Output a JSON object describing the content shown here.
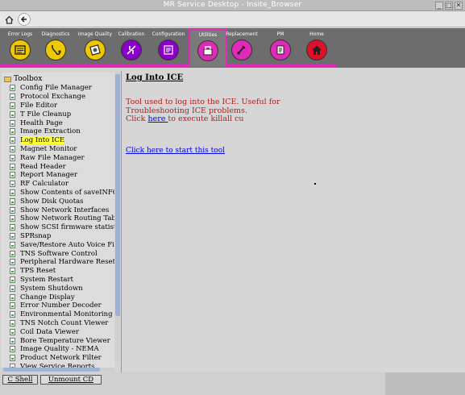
{
  "window": {
    "title": "MR Service Desktop - Insite_Browser",
    "buttons": {
      "minimize": "_",
      "maximize": "□",
      "close": "✕"
    }
  },
  "toolbar": {
    "home_icon": "home-icon",
    "back_icon": "back-arrow-icon",
    "tools": [
      {
        "label": "Error Logs",
        "icon": "error-logs-icon",
        "color": "#f0c800"
      },
      {
        "label": "Diagnostics",
        "icon": "stethoscope-icon",
        "color": "#f0c800"
      },
      {
        "label": "Image Quality",
        "icon": "image-quality-icon",
        "color": "#f0c800"
      },
      {
        "label": "Calibration",
        "icon": "calibration-icon",
        "color": "#8a00c8"
      },
      {
        "label": "Configuration",
        "icon": "configuration-icon",
        "color": "#8a00c8"
      },
      {
        "label": "Utilities",
        "icon": "utilities-icon",
        "color": "#e02ab8",
        "active": true
      },
      {
        "label": "Replacement",
        "icon": "replacement-icon",
        "color": "#e02ab8"
      },
      {
        "label": "PM",
        "icon": "pm-icon",
        "color": "#e02ab8"
      },
      {
        "label": "Home",
        "icon": "home-red-icon",
        "color": "#e0102a"
      }
    ]
  },
  "sidebar": {
    "root_label": "Toolbox",
    "items": [
      {
        "label": "Config File Manager"
      },
      {
        "label": "Protocol Exchange"
      },
      {
        "label": "File Editor"
      },
      {
        "label": "T File Cleanup"
      },
      {
        "label": "Health Page"
      },
      {
        "label": "Image Extraction"
      },
      {
        "label": "Log Into ICE",
        "selected": true
      },
      {
        "label": "Magnet Monitor"
      },
      {
        "label": "Raw File Manager"
      },
      {
        "label": "Read Header"
      },
      {
        "label": "Report Manager"
      },
      {
        "label": "RF Calculator"
      },
      {
        "label": "Show Contents of saveINFO"
      },
      {
        "label": "Show Disk Quotas"
      },
      {
        "label": "Show Network Interfaces"
      },
      {
        "label": "Show Network Routing Tabl"
      },
      {
        "label": "Show SCSI firmware statisti"
      },
      {
        "label": "SPRsnap"
      },
      {
        "label": "Save/Restore Auto Voice Fil"
      },
      {
        "label": "TNS Software Control"
      },
      {
        "label": "Peripheral Hardware Reset"
      },
      {
        "label": "TPS Reset"
      },
      {
        "label": "System Restart"
      },
      {
        "label": "System Shutdown"
      },
      {
        "label": "Change Display"
      },
      {
        "label": "Error Number Decoder"
      },
      {
        "label": "Environmental Monitoring"
      },
      {
        "label": "TNS Notch Count Viewer"
      },
      {
        "label": "Coil Data Viewer"
      },
      {
        "label": "Bore Temperature Viewer"
      },
      {
        "label": "Image Quality - NEMA"
      },
      {
        "label": "Product Network Filter"
      },
      {
        "label": "View Service Reports"
      }
    ]
  },
  "bottom": {
    "cshell_label": "C Shell",
    "unmount_label": "Unmount CD"
  },
  "main": {
    "title": "Log Into ICE",
    "desc_line1": "Tool used to log into the ICE. Useful for",
    "desc_line2": "Troubleshooting ICE problems.",
    "desc_click": "Click ",
    "desc_here": "here ",
    "desc_after": "to execute killall cu",
    "start_link": "Click here to start this tool"
  }
}
